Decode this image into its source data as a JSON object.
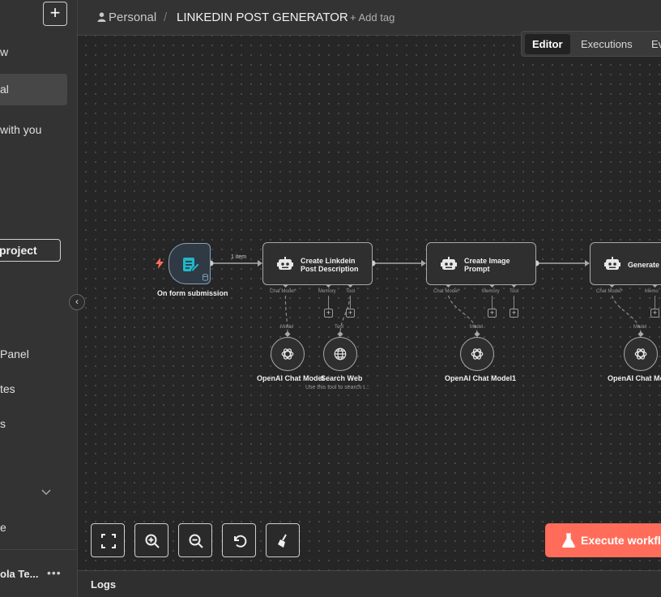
{
  "sidebar": {
    "add_symbol": "+",
    "items": [
      {
        "label": "w"
      },
      {
        "label": "al"
      },
      {
        "label": "with you"
      },
      {
        "label": "Panel"
      },
      {
        "label": "tes"
      },
      {
        "label": "s"
      },
      {
        "label": "e"
      }
    ],
    "project_button": "project",
    "user_name": "ola Te...",
    "more": "•••",
    "collapse_symbol": "‹"
  },
  "header": {
    "breadcrumb_owner": "Personal",
    "separator": "/",
    "title": "LINKEDIN POST GENERATOR",
    "add_tag": "+ Add tag"
  },
  "tabs": [
    {
      "label": "Editor",
      "active": true
    },
    {
      "label": "Executions",
      "active": false
    },
    {
      "label": "Ev",
      "active": false
    }
  ],
  "workflow": {
    "trigger": {
      "name": "On form submission"
    },
    "connection_label": "1 item",
    "nodes": [
      {
        "title_line1": "Create Linkdein",
        "title_line2": "Post Description",
        "ports": [
          "Chat Model*",
          "Memory",
          "Tool"
        ]
      },
      {
        "title_line1": "Create Image",
        "title_line2": "Prompt",
        "ports": [
          "Chat Model*",
          "Memory",
          "Tool"
        ]
      },
      {
        "title_line1": "Generate T",
        "title_line2": "",
        "ports": [
          "Chat Model*",
          "Memo"
        ]
      }
    ],
    "sub_nodes": [
      {
        "name": "OpenAI Chat Model",
        "port_label": "Model"
      },
      {
        "name": "Search Web",
        "port_label": "Tool",
        "subtitle": "Use this tool to search t..."
      },
      {
        "name": "OpenAI Chat Model1",
        "port_label": "Model"
      },
      {
        "name": "OpenAI Chat Mo",
        "port_label": "Model"
      }
    ],
    "plus": "+"
  },
  "controls": {
    "execute_label": "Execute workfl"
  },
  "logs": {
    "label": "Logs"
  },
  "colors": {
    "accent": "#ff6d5a",
    "trigger_bg": "#2f3a45",
    "form_icon": "#1fb8c8"
  }
}
